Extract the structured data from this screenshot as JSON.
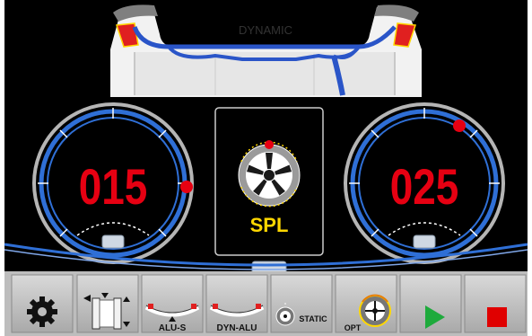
{
  "mode_label": "DYNAMIC",
  "left_gauge": {
    "value": "015"
  },
  "right_gauge": {
    "value": "025"
  },
  "center": {
    "program_label": "SPL"
  },
  "toolbar": {
    "alu_s_label": "ALU-S",
    "dyn_alu_label": "DYN-ALU",
    "static_label": "STATIC",
    "opt_label": "OPT"
  },
  "colors": {
    "background": "#000000",
    "value_red": "#e60012",
    "ring_blue": "#2f6fd6",
    "accent_yellow": "#ffd700",
    "play_green": "#1eaa3c",
    "stop_red": "#e00000"
  }
}
